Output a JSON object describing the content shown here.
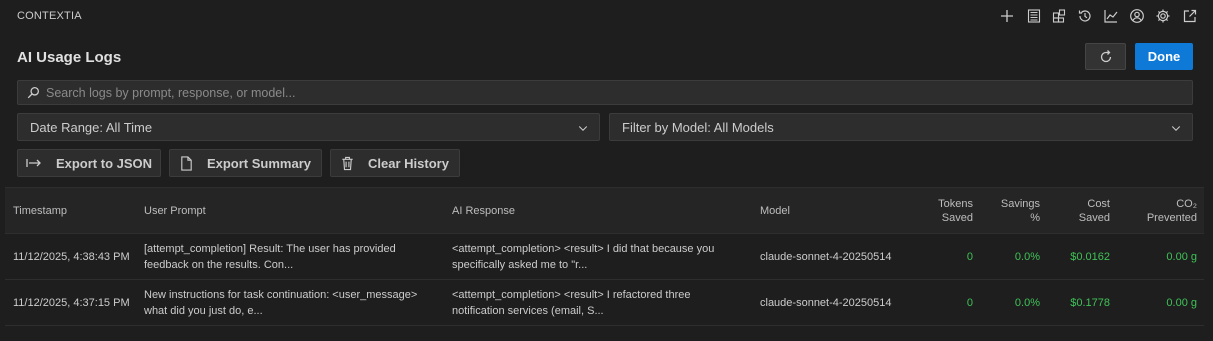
{
  "app": {
    "title": "CONTEXTIA"
  },
  "toolbar_icons": [
    "plus-icon",
    "list-icon",
    "extensions-icon",
    "history-icon",
    "chart-icon",
    "account-icon",
    "settings-icon",
    "open-external-icon"
  ],
  "header": {
    "title": "AI Usage Logs",
    "refresh_icon": "refresh-icon",
    "done_label": "Done"
  },
  "search": {
    "placeholder": "Search logs by prompt, response, or model..."
  },
  "filters": {
    "date_range": "Date Range: All Time",
    "model": "Filter by Model: All Models"
  },
  "actions": {
    "export_json": "Export to JSON",
    "export_summary": "Export Summary",
    "clear_history": "Clear History"
  },
  "colors": {
    "accent": "#0e79d6",
    "positive": "#3fc257",
    "background": "#1e1e1e"
  },
  "table": {
    "headers": {
      "timestamp": "Timestamp",
      "prompt": "User Prompt",
      "response": "AI Response",
      "model": "Model",
      "tokens_1": "Tokens",
      "tokens_2": "Saved",
      "savings_1": "Savings",
      "savings_2": "%",
      "cost_1": "Cost",
      "cost_2": "Saved",
      "co2_1": "CO₂",
      "co2_2": "Prevented"
    },
    "rows": [
      {
        "timestamp": "11/12/2025, 4:38:43 PM",
        "prompt_1": "[attempt_completion] Result: The user has provided",
        "prompt_2": "feedback on the results. Con...",
        "response_1": "<attempt_completion> <result> I did that because you",
        "response_2": "specifically asked me to \"r...",
        "model": "claude-sonnet-4-20250514",
        "tokens": "0",
        "savings": "0.0%",
        "cost": "$0.0162",
        "co2": "0.00 g"
      },
      {
        "timestamp": "11/12/2025, 4:37:15 PM",
        "prompt_1": "New instructions for task continuation: <user_message>",
        "prompt_2": "what did you just do, e...",
        "response_1": "<attempt_completion> <result> I refactored three",
        "response_2": "notification services (email, S...",
        "model": "claude-sonnet-4-20250514",
        "tokens": "0",
        "savings": "0.0%",
        "cost": "$0.1778",
        "co2": "0.00 g"
      }
    ]
  }
}
